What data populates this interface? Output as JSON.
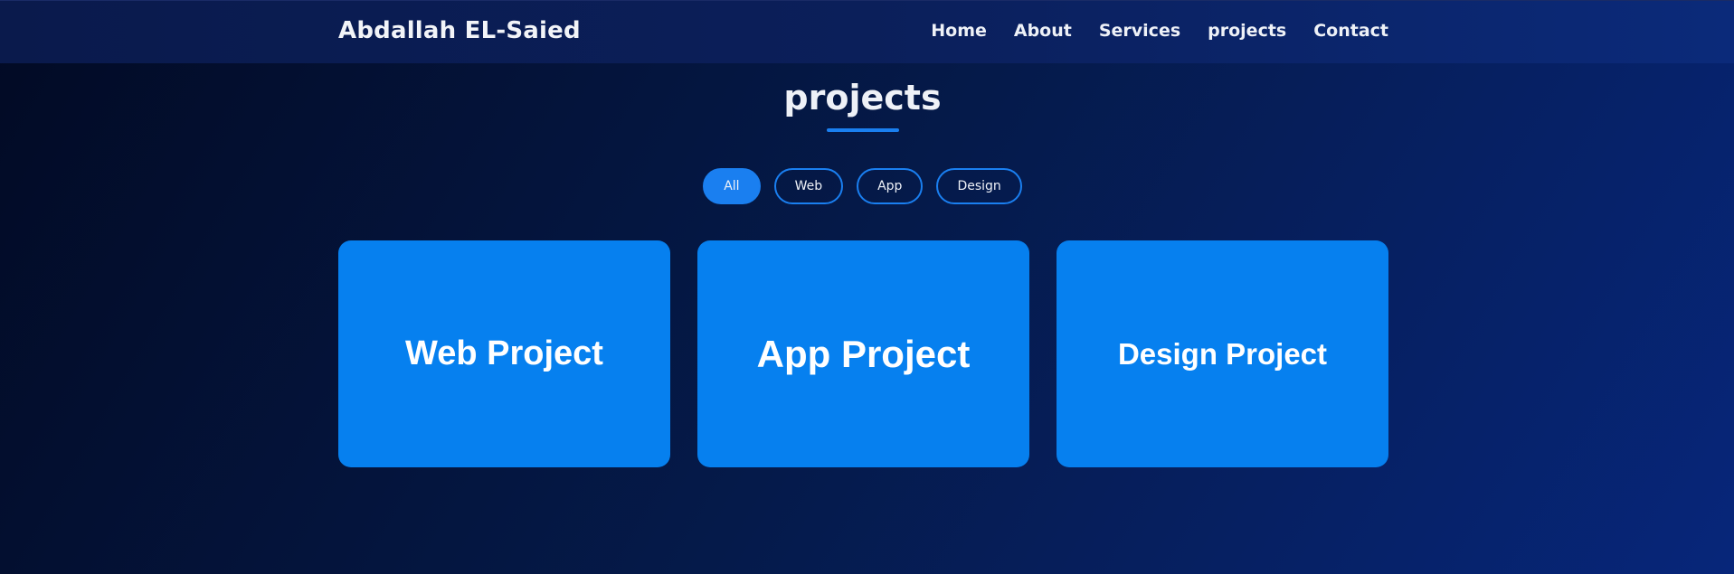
{
  "header": {
    "brand": "Abdallah EL-Saied",
    "nav": [
      {
        "label": "Home"
      },
      {
        "label": "About"
      },
      {
        "label": "Services"
      },
      {
        "label": "projects"
      },
      {
        "label": "Contact"
      }
    ]
  },
  "section": {
    "title": "projects",
    "filters": [
      {
        "label": "All",
        "active": true
      },
      {
        "label": "Web",
        "active": false
      },
      {
        "label": "App",
        "active": false
      },
      {
        "label": "Design",
        "active": false
      }
    ],
    "cards": [
      {
        "label": "Web Project"
      },
      {
        "label": "App Project"
      },
      {
        "label": "Design Project"
      }
    ]
  },
  "colors": {
    "accent": "#1a7ff0",
    "card_bg": "#0680ef",
    "background_dark": "#020a24",
    "background_light": "#07267a"
  }
}
